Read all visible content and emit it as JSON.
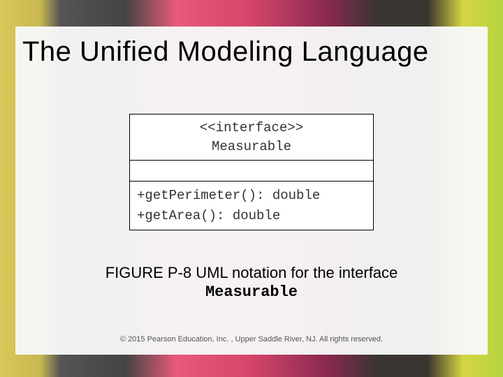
{
  "slide": {
    "title": "The Unified Modeling Language"
  },
  "uml": {
    "stereotype": "<<interface>>",
    "name": "Measurable",
    "methods": {
      "m1": "+getPerimeter(): double",
      "m2": "+getArea(): double"
    }
  },
  "caption": {
    "prefix": "FIGURE P-8 UML notation for the interface",
    "name": "Measurable"
  },
  "footer": {
    "copyright": "© 2015 Pearson Education, Inc. , Upper Saddle River, NJ.  All rights reserved."
  }
}
